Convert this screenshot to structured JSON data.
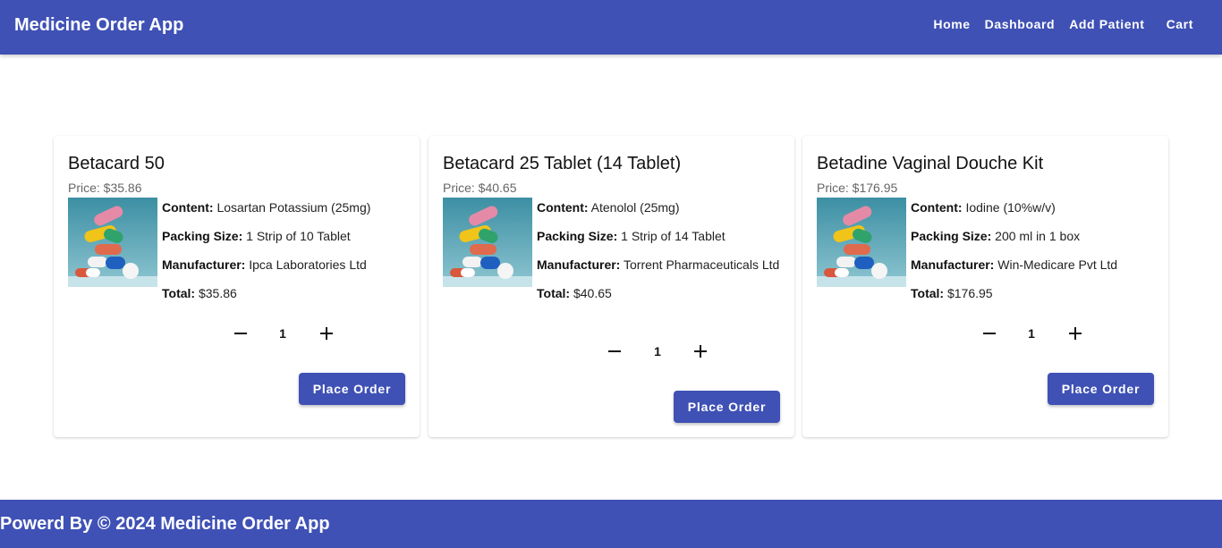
{
  "app": {
    "title": "Medicine Order App",
    "nav": [
      "Home",
      "Dashboard",
      "Add Patient",
      "Cart"
    ],
    "accent_color": "#3f51b5"
  },
  "labels": {
    "content": "Content:",
    "packing": "Packing Size:",
    "manufacturer": "Manufacturer:",
    "total": "Total:",
    "place_order": "Place Order"
  },
  "products": [
    {
      "name": "Betacard 50",
      "price": "Price: $35.86",
      "content": "Losartan Potassium (25mg)",
      "packing": "1 Strip of 10 Tablet",
      "manufacturer": "Ipca Laboratories Ltd",
      "total": "$35.86",
      "qty": "1",
      "image_icon": "pills-image"
    },
    {
      "name": "Betacard 25 Tablet (14 Tablet)",
      "price": "Price: $40.65",
      "content": "Atenolol (25mg)",
      "packing": "1 Strip of 14 Tablet",
      "manufacturer": "Torrent Pharmaceuticals Ltd",
      "total": "$40.65",
      "qty": "1",
      "image_icon": "pills-image"
    },
    {
      "name": "Betadine Vaginal Douche Kit",
      "price": "Price: $176.95",
      "content": "Iodine (10%w/v)",
      "packing": "200 ml in 1 box",
      "manufacturer": "Win-Medicare Pvt Ltd",
      "total": "$176.95",
      "qty": "1",
      "image_icon": "pills-image"
    }
  ],
  "footer": {
    "text": "Powerd By © 2024 Medicine Order App"
  }
}
